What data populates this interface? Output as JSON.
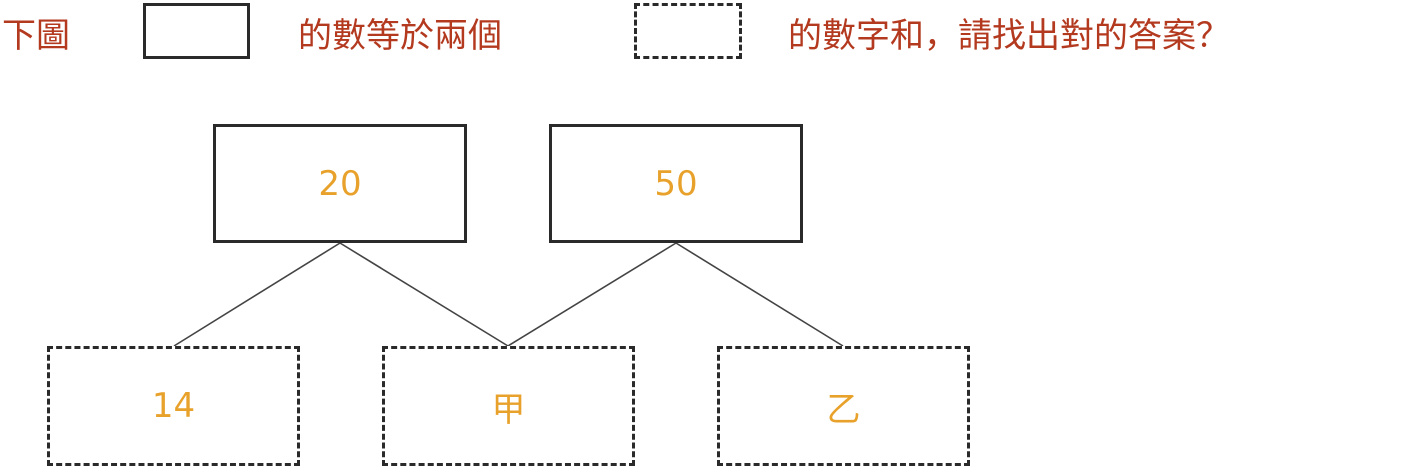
{
  "prompt": {
    "part1": "下圖",
    "part2": "的數等於兩個",
    "part3": "的數字和，請找出對的答案？"
  },
  "legend": {
    "solid_box": "solid",
    "dashed_box": "dashed"
  },
  "diagram": {
    "top_boxes": [
      "20",
      "50"
    ],
    "bottom_boxes": [
      "14",
      "甲",
      "乙"
    ],
    "connections": [
      {
        "from": "20",
        "to": "14"
      },
      {
        "from": "20",
        "to": "甲"
      },
      {
        "from": "50",
        "to": "甲"
      },
      {
        "from": "50",
        "to": "乙"
      }
    ]
  },
  "colors": {
    "prompt_text": "#b3391f",
    "box_text": "#e8a22b",
    "border": "#2a2a2a",
    "line": "#444444"
  }
}
